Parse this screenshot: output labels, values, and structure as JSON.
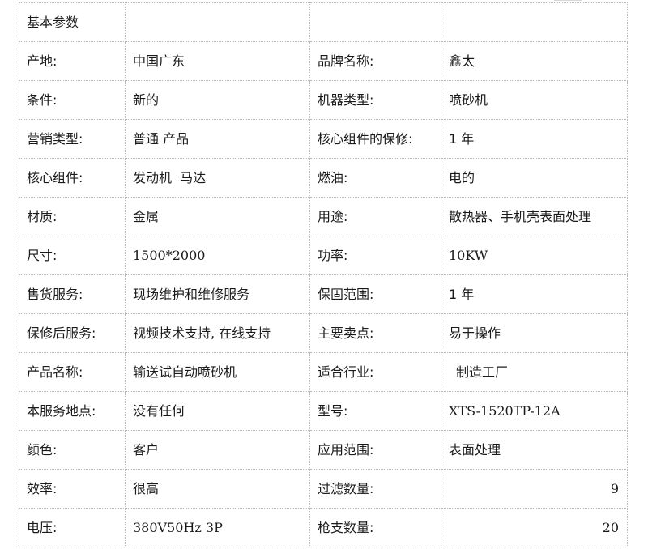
{
  "section_title": "基本参数",
  "rows": [
    {
      "label1": "产地:",
      "value1": "中国广东",
      "label2": "品牌名称:",
      "value2": "鑫太"
    },
    {
      "label1": "条件:",
      "value1": "新的",
      "label2": "机器类型:",
      "value2": "喷砂机"
    },
    {
      "label1": "营销类型:",
      "value1": "普通 产品",
      "label2": "核心组件的保修:",
      "value2": "1 年"
    },
    {
      "label1": "核心组件:",
      "value1": "发动机  马达",
      "label2": "燃油:",
      "value2": "电的"
    },
    {
      "label1": "材质:",
      "value1": "金属",
      "label2": "用途:",
      "value2": "散热器、手机壳表面处理"
    },
    {
      "label1": "尺寸:",
      "value1": "1500*2000",
      "label2": "功率:",
      "value2": "10KW"
    },
    {
      "label1": "售货服务:",
      "value1": "现场维护和维修服务",
      "label2": "保固范围:",
      "value2": "1 年"
    },
    {
      "label1": "保修后服务:",
      "value1": "视频技术支持, 在线支持",
      "label2": "主要卖点:",
      "value2": "易于操作"
    },
    {
      "label1": "产品名称:",
      "value1": "输送试自动喷砂机",
      "label2": "适合行业:",
      "value2": "制造工厂"
    },
    {
      "label1": "本服务地点:",
      "value1": "没有任何",
      "label2": "型号:",
      "value2": "XTS-1520TP-12A"
    },
    {
      "label1": "颜色:",
      "value1": "客户",
      "label2": "应用范围:",
      "value2": "表面处理"
    },
    {
      "label1": "效率:",
      "value1": "很高",
      "label2": "过滤数量:",
      "value2": "9"
    },
    {
      "label1": "电压:",
      "value1": "380V50Hz 3P",
      "label2": "枪支数量:",
      "value2": "20"
    }
  ]
}
